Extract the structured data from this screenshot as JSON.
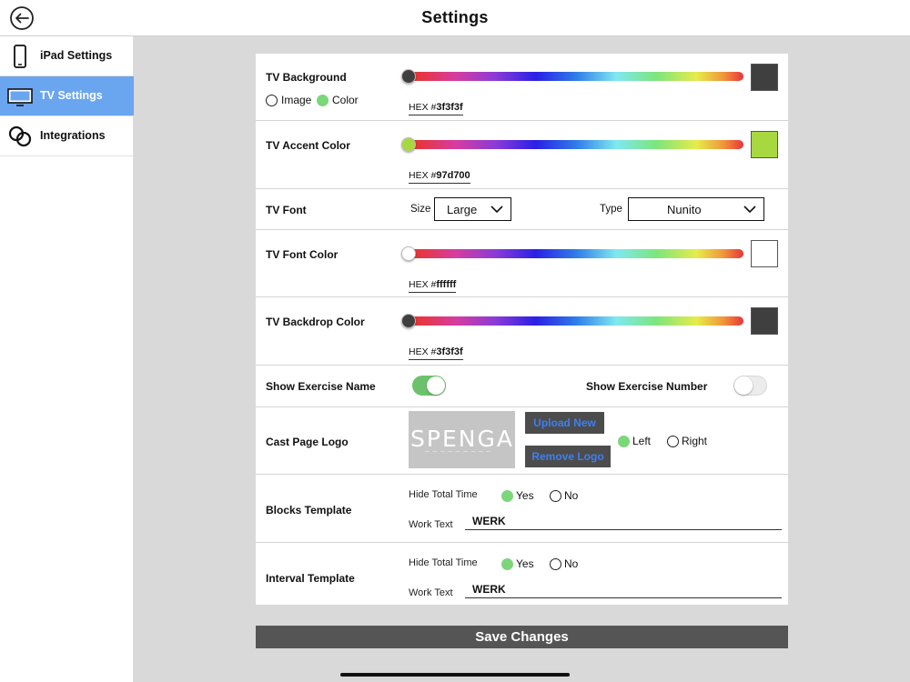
{
  "header": {
    "title": "Settings",
    "back_icon": "back-arrow-icon"
  },
  "sidebar": {
    "items": [
      {
        "label": "iPad Settings",
        "icon": "ipad-icon",
        "active": false
      },
      {
        "label": "TV Settings",
        "icon": "tv-icon",
        "active": true
      },
      {
        "label": "Integrations",
        "icon": "link-icon",
        "active": false
      }
    ]
  },
  "tv_background": {
    "label": "TV Background",
    "source_options": [
      "Image",
      "Color"
    ],
    "source_selected": "Color",
    "hex_prefix": "HEX #",
    "hex_value": "3f3f3f",
    "color": "#3f3f3f"
  },
  "tv_accent": {
    "label": "TV Accent Color",
    "hex_prefix": "HEX #",
    "hex_value": "97d700",
    "color": "#97d700"
  },
  "tv_font": {
    "label": "TV Font",
    "size_label": "Size",
    "size_value": "Large",
    "type_label": "Type",
    "type_value": "Nunito"
  },
  "tv_font_color": {
    "label": "TV Font Color",
    "hex_prefix": "HEX #",
    "hex_value": "ffffff",
    "color": "#ffffff"
  },
  "tv_backdrop": {
    "label": "TV Backdrop Color",
    "hex_prefix": "HEX #",
    "hex_value": "3f3f3f",
    "color": "#3f3f3f"
  },
  "exercise": {
    "name_label": "Show Exercise Name",
    "name_on": true,
    "number_label": "Show Exercise Number",
    "number_on": false
  },
  "cast_logo": {
    "label": "Cast Page Logo",
    "logo_text": "SPENGA",
    "upload_label": "Upload New",
    "remove_label": "Remove Logo",
    "align_left": "Left",
    "align_right": "Right",
    "align_selected": "Left"
  },
  "blocks_template": {
    "label": "Blocks Template",
    "hide_label": "Hide Total Time",
    "yes": "Yes",
    "no": "No",
    "hide_selected": "Yes",
    "work_label": "Work Text",
    "work_value": "WERK"
  },
  "interval_template": {
    "label": "Interval Template",
    "hide_label": "Hide Total Time",
    "yes": "Yes",
    "no": "No",
    "hide_selected": "Yes",
    "work_label": "Work Text",
    "work_value": "WERK"
  },
  "save_label": "Save Changes",
  "colors": {
    "accent_blue": "#6aa5f0",
    "toggle_on": "#6cc26a",
    "radio_on": "#7cd67a",
    "save_bg": "#555555"
  }
}
